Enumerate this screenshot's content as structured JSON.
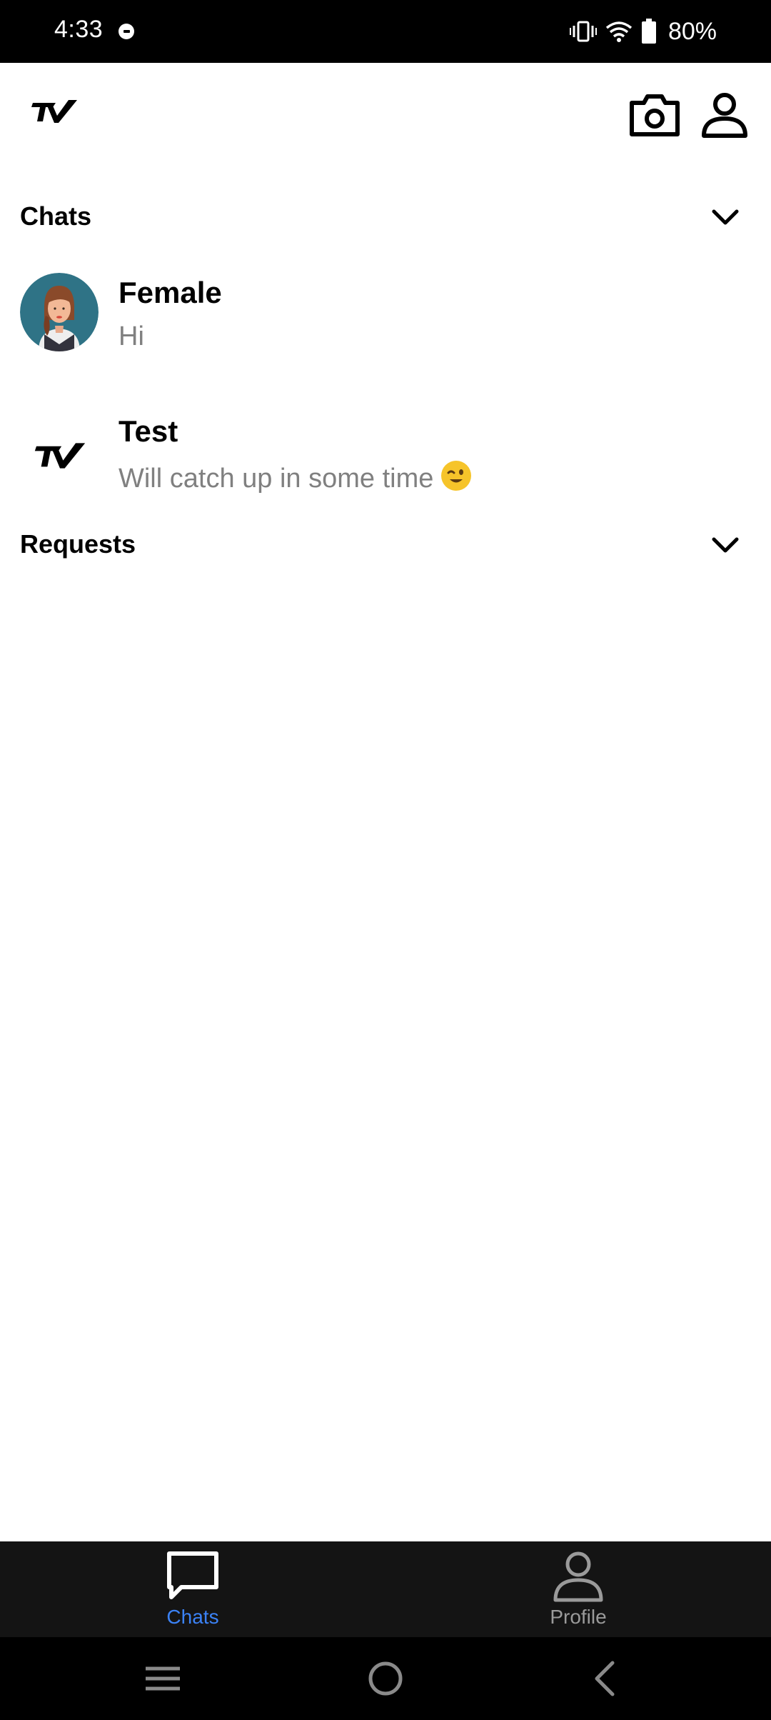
{
  "status_bar": {
    "time": "4:33",
    "battery": "80%"
  },
  "app_bar": {
    "logo_icon": "tv-logo-icon",
    "camera_icon": "camera-icon",
    "profile_icon": "person-icon"
  },
  "chats_section": {
    "title": "Chats",
    "items": [
      {
        "name": "Female",
        "message": "Hi",
        "avatar": "female-avatar"
      },
      {
        "name": "Test",
        "message": "Will catch up in some time",
        "emoji": "wink-emoji",
        "avatar": "tv-logo-icon"
      }
    ]
  },
  "requests_section": {
    "title": "Requests"
  },
  "bottom_nav": {
    "items": [
      {
        "label": "Chats",
        "icon": "chat-bubble-icon",
        "active": true
      },
      {
        "label": "Profile",
        "icon": "person-icon",
        "active": false
      }
    ]
  },
  "colors": {
    "accent": "#3b82f6",
    "muted_text": "#808080",
    "nav_bg": "#141414",
    "avatar_bg": "#2f7386"
  }
}
